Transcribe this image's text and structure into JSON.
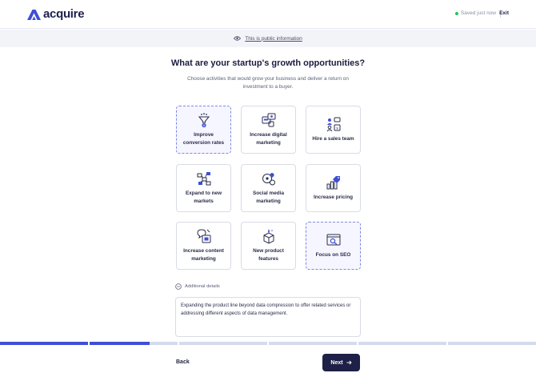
{
  "header": {
    "brand": "acquire",
    "saved_status": "Saved just now",
    "exit_label": "Exit"
  },
  "banner": {
    "text": "This is public information",
    "icon": "eye-icon"
  },
  "main": {
    "title": "What are your startup's growth opportunities?",
    "subtitle": "Choose activities that would grow your business and deliver a return on investment to a buyer."
  },
  "options": [
    {
      "label": "Improve conversion rates",
      "icon": "funnel-icon",
      "selected": true
    },
    {
      "label": "Increase digital marketing",
      "icon": "devices-icon",
      "selected": false
    },
    {
      "label": "Hire a sales team",
      "icon": "team-icon",
      "selected": false
    },
    {
      "label": "Expand to new markets",
      "icon": "network-icon",
      "selected": false
    },
    {
      "label": "Social media marketing",
      "icon": "social-icon",
      "selected": false
    },
    {
      "label": "Increase pricing",
      "icon": "price-chart-icon",
      "selected": false
    },
    {
      "label": "Increase content marketing",
      "icon": "content-icon",
      "selected": false
    },
    {
      "label": "New product features",
      "icon": "box-icon",
      "selected": false
    },
    {
      "label": "Focus on SEO",
      "icon": "seo-icon",
      "selected": true
    }
  ],
  "details": {
    "toggle_label": "Additional details",
    "text": "Expanding the product line beyond data compression to offer related services or addressing different aspects of data management."
  },
  "progress": {
    "steps": [
      1,
      0.68,
      0,
      0,
      0,
      0
    ]
  },
  "footer": {
    "back_label": "Back",
    "next_label": "Next"
  },
  "colors": {
    "accent": "#3f4fd6",
    "navy": "#1e2047",
    "selected_border": "#7f88e0",
    "saved_dot": "#22c55e"
  }
}
